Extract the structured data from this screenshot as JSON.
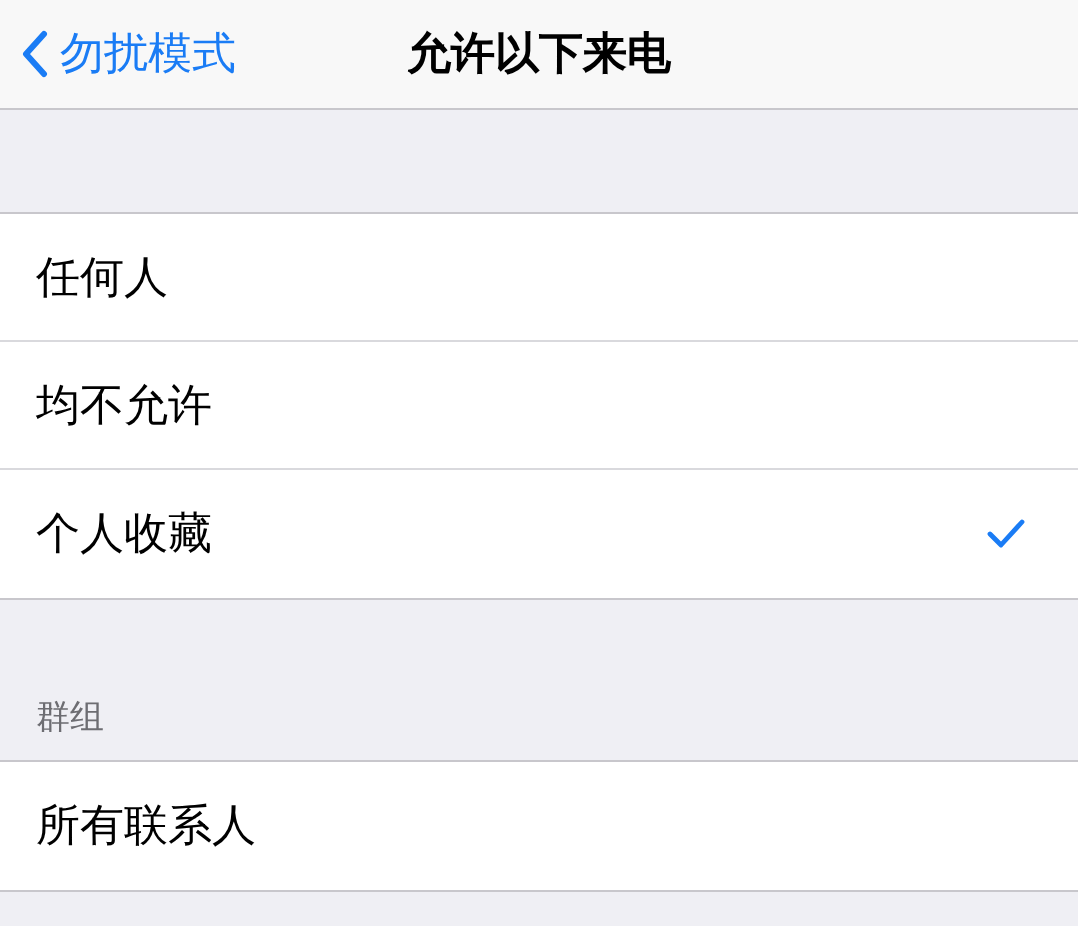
{
  "nav_bar": {
    "back_label": "勿扰模式",
    "title": "允许以下来电"
  },
  "options": [
    {
      "label": "任何人",
      "selected": false
    },
    {
      "label": "均不允许",
      "selected": false
    },
    {
      "label": "个人收藏",
      "selected": true
    }
  ],
  "groups": {
    "header": "群组",
    "items": [
      {
        "label": "所有联系人",
        "selected": false
      }
    ]
  }
}
